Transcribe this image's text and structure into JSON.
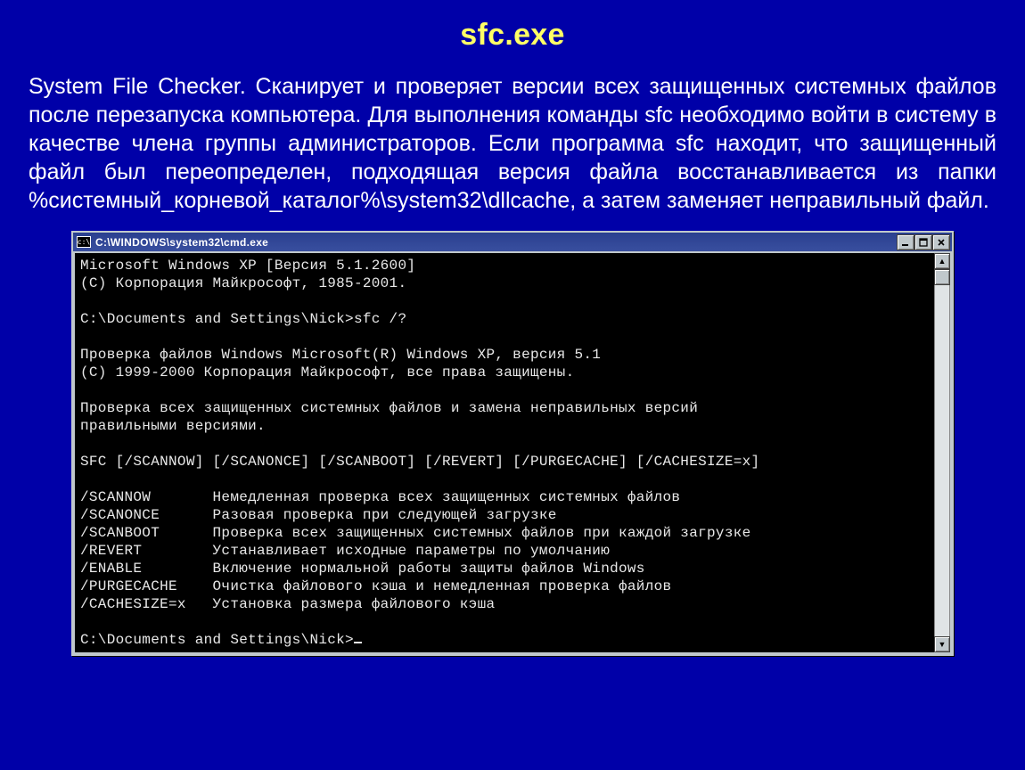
{
  "title": "sfc.exe",
  "description": "System File Checker. Сканирует и проверяет версии всех защищенных системных файлов после перезапуска компьютера. Для выполнения команды sfc необходимо войти в систему в качестве члена группы администраторов. Если программа sfc находит, что защищенный файл был переопределен, подходящая версия файла восстанавливается из папки %системный_корневой_каталог%\\system32\\dllcache, а затем заменяет неправильный файл.",
  "cmd": {
    "title": "C:\\WINDOWS\\system32\\cmd.exe",
    "icon_glyph": "c:\\",
    "buttons": {
      "min": "minimize",
      "max": "maximize",
      "close": "close"
    },
    "lines": [
      "Microsoft Windows XP [Версия 5.1.2600]",
      "(С) Корпорация Майкрософт, 1985-2001.",
      "",
      "C:\\Documents and Settings\\Nick>sfc /?",
      "",
      "Проверка файлов Windows Microsoft(R) Windows XP, версия 5.1",
      "(C) 1999-2000 Корпорация Майкрософт, все права защищены.",
      "",
      "Проверка всех защищенных системных файлов и замена неправильных версий",
      "правильными версиями.",
      "",
      "SFC [/SCANNOW] [/SCANONCE] [/SCANBOOT] [/REVERT] [/PURGECACHE] [/CACHESIZE=x]",
      ""
    ],
    "options": [
      {
        "flag": "/SCANNOW",
        "desc": "Немедленная проверка всех защищенных системных файлов"
      },
      {
        "flag": "/SCANONCE",
        "desc": "Разовая проверка при следующей загрузке"
      },
      {
        "flag": "/SCANBOOT",
        "desc": "Проверка всех защищенных системных файлов при каждой загрузке"
      },
      {
        "flag": "/REVERT",
        "desc": "Устанавливает исходные параметры по умолчанию"
      },
      {
        "flag": "/ENABLE",
        "desc": "Включение нормальной работы защиты файлов Windows"
      },
      {
        "flag": "/PURGECACHE",
        "desc": "Очистка файлового кэша и немедленная проверка файлов"
      },
      {
        "flag": "/CACHESIZE=x",
        "desc": "Установка размера файлового кэша"
      }
    ],
    "prompt": "C:\\Documents and Settings\\Nick>"
  }
}
